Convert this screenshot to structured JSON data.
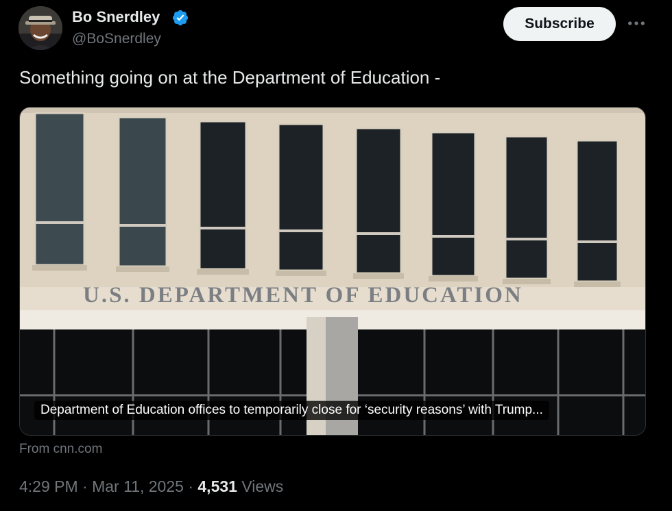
{
  "author": {
    "display_name": "Bo Snerdley",
    "handle": "@BoSnerdley",
    "verified": true
  },
  "actions": {
    "subscribe_label": "Subscribe",
    "more_icon": "ellipsis-icon"
  },
  "tweet": {
    "text": "Something going on at the Department of Education -"
  },
  "card": {
    "image_sign_text": "U.S. DEPARTMENT OF EDUCATION",
    "headline": "Department of Education offices to temporarily close for ‘security reasons’ with Trump...",
    "source": "From cnn.com"
  },
  "meta": {
    "time": "4:29 PM",
    "separator": "·",
    "date": "Mar 11, 2025",
    "views_count": "4,531",
    "views_label": "Views"
  },
  "colors": {
    "background": "#000000",
    "text_primary": "#e7e9ea",
    "text_secondary": "#71767b",
    "verified_blue": "#1d9bf0",
    "button_bg": "#eff3f4"
  }
}
